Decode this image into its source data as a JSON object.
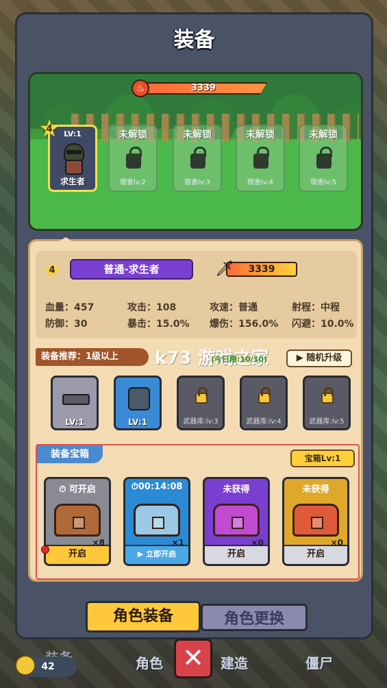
{
  "title": "装备",
  "power_top": "3339",
  "slots": [
    {
      "lv": "LV:1",
      "name": "求生者",
      "star": "4"
    },
    {
      "label": "未解锁",
      "dorm": "宿舍lv:2"
    },
    {
      "label": "未解锁",
      "dorm": "宿舍lv:3"
    },
    {
      "label": "未解锁",
      "dorm": "宿舍lv:4"
    },
    {
      "label": "未解锁",
      "dorm": "宿舍lv:5"
    }
  ],
  "character": {
    "star": "4",
    "name": "普通-求生者",
    "power": "3339"
  },
  "stats": [
    {
      "label": "血量",
      "value": "457"
    },
    {
      "label": "攻击",
      "value": "108"
    },
    {
      "label": "攻速",
      "value": "普通"
    },
    {
      "label": "射程",
      "value": "中程"
    },
    {
      "label": "防御",
      "value": "30"
    },
    {
      "label": "暴击",
      "value": "15.0%"
    },
    {
      "label": "爆伤",
      "value": "156.0%"
    },
    {
      "label": "闪避",
      "value": "10.0%"
    }
  ],
  "recommend": "装备推荐：1级以上",
  "daily_limit": "(今日限:10/10)",
  "random_upgrade": "随机升级",
  "equipment": [
    {
      "lv": "LV:1",
      "type": "gun"
    },
    {
      "lv": "LV:1",
      "type": "armor"
    },
    {
      "locked": "武器库:lv:3"
    },
    {
      "locked": "武器库:lv:4"
    },
    {
      "locked": "武器库:lv:5"
    }
  ],
  "chest_section": {
    "title": "装备宝箱",
    "level": "宝箱Lv:1"
  },
  "chests": [
    {
      "top": "可开启",
      "count": "×8",
      "button": "开启",
      "color": "#8a8a94",
      "box": "#b06a3a",
      "btncolor": "#ffc83a"
    },
    {
      "top": "00:14:08",
      "count": "×1",
      "button": "立即开启",
      "color": "#2a8ad6",
      "box": "#9ac8e6",
      "btncolor": "#4aa8e6"
    },
    {
      "top": "未获得",
      "count": "×0",
      "button": "开启",
      "color": "#7a3fd1",
      "box": "#c04ad0",
      "btncolor": "#d8d8e0"
    },
    {
      "top": "未获得",
      "count": "×0",
      "button": "开启",
      "color": "#e0a82a",
      "box": "#e05a3a",
      "btncolor": "#d8d8e0"
    }
  ],
  "tabs": {
    "equip": "角色装备",
    "change": "角色更换"
  },
  "bottom": {
    "coins": "42",
    "role": "角色",
    "build": "建造",
    "zombie": "僵尸",
    "left_cut": "装备"
  },
  "watermark": "k73 游戏之家"
}
